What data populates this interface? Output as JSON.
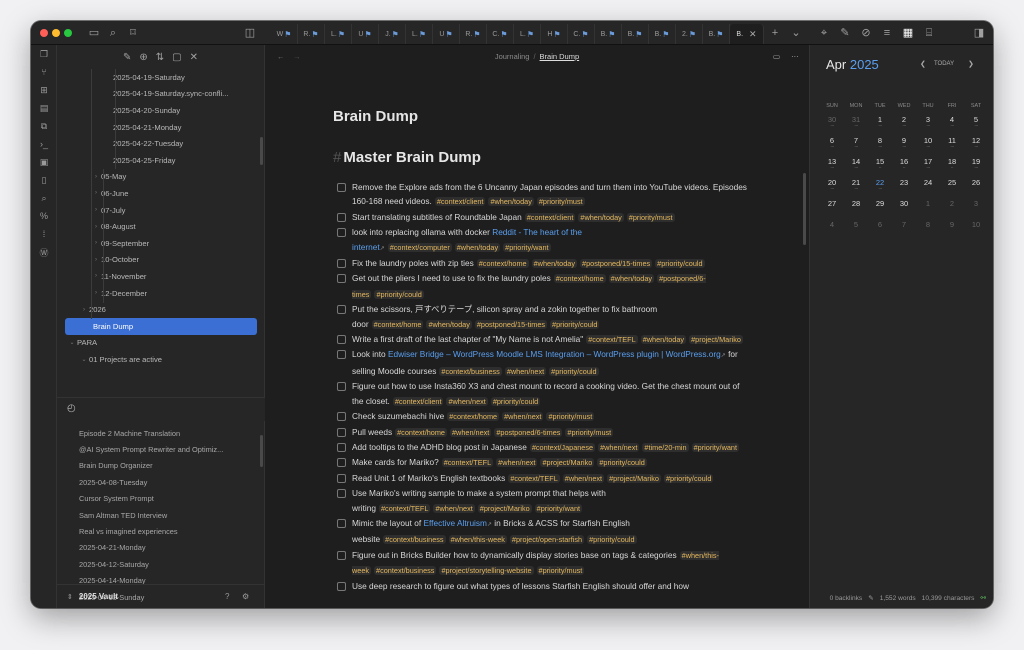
{
  "tabs": [
    {
      "label": "W"
    },
    {
      "label": "R."
    },
    {
      "label": "L."
    },
    {
      "label": "U"
    },
    {
      "label": "J."
    },
    {
      "label": "L."
    },
    {
      "label": "U"
    },
    {
      "label": "R."
    },
    {
      "label": "C."
    },
    {
      "label": "L."
    },
    {
      "label": "H"
    },
    {
      "label": "C."
    },
    {
      "label": "B."
    },
    {
      "label": "B."
    },
    {
      "label": "B."
    },
    {
      "label": "2."
    },
    {
      "label": "B."
    }
  ],
  "active_tab": {
    "label": "B."
  },
  "breadcrumb": {
    "parent": "Journaling",
    "current": "Brain Dump"
  },
  "tree": [
    {
      "label": "2025-04-19-Saturday",
      "indent": 3
    },
    {
      "label": "2025-04-19-Saturday.sync-confli...",
      "indent": 3
    },
    {
      "label": "2025-04-20-Sunday",
      "indent": 3
    },
    {
      "label": "2025-04-21-Monday",
      "indent": 3
    },
    {
      "label": "2025-04-22-Tuesday",
      "indent": 3
    },
    {
      "label": "2025-04-25-Friday",
      "indent": 3
    },
    {
      "label": "05-May",
      "indent": 2,
      "caret": true
    },
    {
      "label": "06-June",
      "indent": 2,
      "caret": true
    },
    {
      "label": "07-July",
      "indent": 2,
      "caret": true
    },
    {
      "label": "08-August",
      "indent": 2,
      "caret": true
    },
    {
      "label": "09-September",
      "indent": 2,
      "caret": true
    },
    {
      "label": "10-October",
      "indent": 2,
      "caret": true
    },
    {
      "label": "11-November",
      "indent": 2,
      "caret": true
    },
    {
      "label": "12-December",
      "indent": 2,
      "caret": true
    },
    {
      "label": "2026",
      "indent": 1,
      "caret": true
    },
    {
      "label": "Brain Dump",
      "indent": 1,
      "selected": true
    },
    {
      "label": "PARA",
      "indent": 0,
      "caret": true
    },
    {
      "label": "01 Projects are active",
      "indent": 1,
      "caret": true
    }
  ],
  "recent": [
    "Episode 2 Machine Translation",
    "@AI System Prompt Rewriter and Optimiz...",
    "Brain Dump Organizer",
    "2025-04-08-Tuesday",
    "Cursor System Prompt",
    "Sam Altman TED Interview",
    "Real vs imagined experiences",
    "2025-04-21-Monday",
    "2025-04-12-Saturday",
    "2025-04-14-Monday",
    "2025-04-13-Sunday"
  ],
  "vault_name": "2025 Vault",
  "note_title": "Brain Dump",
  "heading": "Master Brain Dump",
  "tasks": [
    {
      "parts": [
        {
          "t": "Remove the Explore ads from the 6 Uncanny Japan episodes and turn them into YouTube videos. Episodes 160-168 need videos."
        }
      ],
      "tags": [
        "#context/client",
        "#when/today",
        "#priority/must"
      ]
    },
    {
      "parts": [
        {
          "t": "Start translating subtitles of Roundtable Japan"
        }
      ],
      "tags": [
        "#context/client",
        "#when/today",
        "#priority/must"
      ]
    },
    {
      "parts": [
        {
          "t": "look into replacing ollama with docker "
        },
        {
          "link": "Reddit - The heart of the internet"
        }
      ],
      "tags": [
        "#context/computer",
        "#when/today",
        "#priority/want"
      ]
    },
    {
      "parts": [
        {
          "t": "Fix the laundry poles with zip ties"
        }
      ],
      "tags": [
        "#context/home",
        "#when/today",
        "#postponed/15-times",
        "#priority/could"
      ]
    },
    {
      "parts": [
        {
          "t": "Get out the pliers I need to use to fix the laundry poles"
        }
      ],
      "tags": [
        "#context/home",
        "#when/today",
        "#postponed/6-times",
        "#priority/could"
      ]
    },
    {
      "parts": [
        {
          "t": "Put the scissors, 戸すべりテープ, silicon spray and a zokin together to fix bathroom door"
        }
      ],
      "tags": [
        "#context/home",
        "#when/today",
        "#postponed/15-times",
        "#priority/could"
      ]
    },
    {
      "parts": [
        {
          "t": "Write a first draft of the last chapter of \"My Name is not Amelia\""
        }
      ],
      "tags": [
        "#context/TEFL",
        "#when/today",
        "#project/Mariko"
      ]
    },
    {
      "parts": [
        {
          "t": "Look into "
        },
        {
          "link": "Edwiser Bridge – WordPress Moodle LMS Integration – WordPress plugin | WordPress.org"
        },
        {
          "t": " for selling Moodle courses"
        }
      ],
      "tags": [
        "#context/business",
        "#when/next",
        "#priority/could"
      ]
    },
    {
      "parts": [
        {
          "t": "Figure out how to use Insta360 X3 and chest mount to record a cooking video. Get the chest mount out of the closet."
        }
      ],
      "tags": [
        "#context/client",
        "#when/next",
        "#priority/could"
      ]
    },
    {
      "parts": [
        {
          "t": "Check suzumebachi hive"
        }
      ],
      "tags": [
        "#context/home",
        "#when/next",
        "#priority/must"
      ]
    },
    {
      "parts": [
        {
          "t": "Pull weeds"
        }
      ],
      "tags": [
        "#context/home",
        "#when/next",
        "#postponed/6-times",
        "#priority/must"
      ]
    },
    {
      "parts": [
        {
          "t": "Add tooltips to the ADHD blog post in Japanese"
        }
      ],
      "tags": [
        "#context/Japanese",
        "#when/next",
        "#time/20-min",
        "#priority/want"
      ]
    },
    {
      "parts": [
        {
          "t": "Make cards for Mariko?"
        }
      ],
      "tags": [
        "#context/TEFL",
        "#when/next",
        "#project/Mariko",
        "#priority/could"
      ]
    },
    {
      "parts": [
        {
          "t": "Read Unit 1 of Mariko's English textbooks"
        }
      ],
      "tags": [
        "#context/TEFL",
        "#when/next",
        "#project/Mariko",
        "#priority/could"
      ]
    },
    {
      "parts": [
        {
          "t": "Use Mariko's writing sample to make a system prompt that helps with writing"
        }
      ],
      "tags": [
        "#context/TEFL",
        "#when/next",
        "#project/Mariko",
        "#priority/want"
      ]
    },
    {
      "parts": [
        {
          "t": "Mimic the layout of "
        },
        {
          "link": "Effective Altruism"
        },
        {
          "t": " in Bricks & ACSS for Starfish English website"
        }
      ],
      "tags": [
        "#context/business",
        "#when/this-week",
        "#project/open-starfish",
        "#priority/could"
      ]
    },
    {
      "parts": [
        {
          "t": "Figure out in Bricks Builder how to dynamically display stories base on tags & categories"
        }
      ],
      "tags": [
        "#when/this-week",
        "#context/business",
        "#project/storytelling-website",
        "#priority/must"
      ]
    },
    {
      "parts": [
        {
          "t": "Use deep research to figure out what types of lessons Starfish English should offer and how"
        }
      ],
      "tags": []
    }
  ],
  "calendar": {
    "month": "Apr",
    "year": "2025",
    "today_label": "TODAY",
    "weekdays": [
      "SUN",
      "MON",
      "TUE",
      "WED",
      "THU",
      "FRI",
      "SAT"
    ],
    "days": [
      {
        "d": "30",
        "m": true,
        "dots": "···"
      },
      {
        "d": "31",
        "m": true,
        "dots": "···"
      },
      {
        "d": "1",
        "dots": "···"
      },
      {
        "d": "2",
        "dots": "···"
      },
      {
        "d": "3",
        "dots": "···"
      },
      {
        "d": "4",
        "dots": "···"
      },
      {
        "d": "5",
        "dots": "···"
      },
      {
        "d": "6",
        "dots": "···"
      },
      {
        "d": "7",
        "dots": "···"
      },
      {
        "d": "8",
        "dots": "···"
      },
      {
        "d": "9",
        "dots": "···"
      },
      {
        "d": "10",
        "dots": "···"
      },
      {
        "d": "11",
        "dots": "···"
      },
      {
        "d": "12",
        "dots": "···"
      },
      {
        "d": "13",
        "dots": "···"
      },
      {
        "d": "14",
        "dots": "···"
      },
      {
        "d": "15",
        "dots": "··"
      },
      {
        "d": "16",
        "dots": "··"
      },
      {
        "d": "17",
        "dots": "···"
      },
      {
        "d": "18",
        "dots": "··"
      },
      {
        "d": "19",
        "dots": "···"
      },
      {
        "d": "20",
        "dots": "···"
      },
      {
        "d": "21",
        "dots": "···"
      },
      {
        "d": "22",
        "today": true,
        "dots": "···"
      },
      {
        "d": "23"
      },
      {
        "d": "24"
      },
      {
        "d": "25"
      },
      {
        "d": "26"
      },
      {
        "d": "27"
      },
      {
        "d": "28"
      },
      {
        "d": "29"
      },
      {
        "d": "30"
      },
      {
        "d": "1",
        "m": true
      },
      {
        "d": "2",
        "m": true
      },
      {
        "d": "3",
        "m": true
      },
      {
        "d": "4",
        "m": true
      },
      {
        "d": "5",
        "m": true
      },
      {
        "d": "6",
        "m": true
      },
      {
        "d": "7",
        "m": true
      },
      {
        "d": "8",
        "m": true
      },
      {
        "d": "9",
        "m": true
      },
      {
        "d": "10",
        "m": true
      }
    ]
  },
  "status": {
    "backlinks": "0 backlinks",
    "words": "1,552 words",
    "characters": "10,399 characters"
  }
}
